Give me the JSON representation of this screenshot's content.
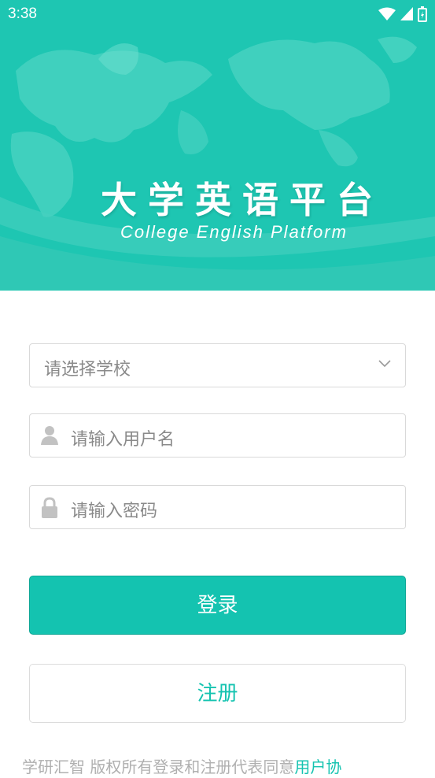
{
  "status_bar": {
    "time": "3:38"
  },
  "banner": {
    "title_cn": "大学英语平台",
    "title_en": "College English Platform"
  },
  "form": {
    "school_placeholder": "请选择学校",
    "username_placeholder": "请输入用户名",
    "password_placeholder": "请输入密码"
  },
  "buttons": {
    "login_label": "登录",
    "register_label": "注册"
  },
  "footer": {
    "text": "学研汇智 版权所有登录和注册代表同意",
    "link": "用户协"
  },
  "colors": {
    "primary": "#14c3b0",
    "banner": "#1ec6b2"
  }
}
